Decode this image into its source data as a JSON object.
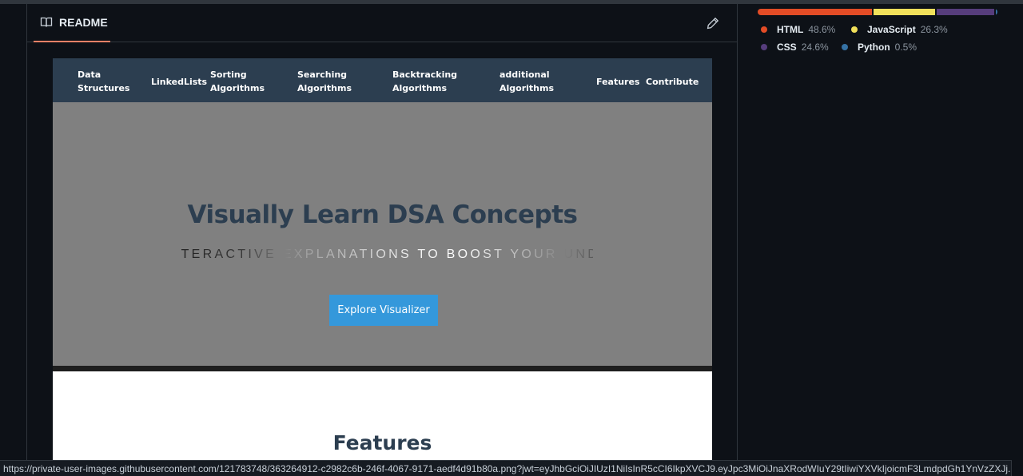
{
  "readme": {
    "tab_label": "README",
    "icons": {
      "tab": "book-icon",
      "edit": "pencil-icon"
    }
  },
  "embedded_site": {
    "nav": [
      {
        "label": "Data Structures"
      },
      {
        "label": "LinkedLists"
      },
      {
        "label": "Sorting Algorithms"
      },
      {
        "label": "Searching Algorithms"
      },
      {
        "label": "Backtracking Algorithms"
      },
      {
        "label": "additional Algorithms"
      },
      {
        "label": "Features"
      },
      {
        "label": "Contribute"
      }
    ],
    "hero_title": "Visually Learn DSA Concepts",
    "hero_subtitle": "INTERACTIVE EXPLANATIONS TO BOOST YOUR UNDERSTANDING",
    "explore_button": "Explore Visualizer",
    "features_title": "Features",
    "colors": {
      "nav_bg": "#2c3e50",
      "hero_bg": "#808080",
      "title": "#2c3e50",
      "button": "#3498db"
    }
  },
  "languages": [
    {
      "name": "HTML",
      "percent": "48.6%",
      "value": 48.6,
      "color": "#e34c26"
    },
    {
      "name": "JavaScript",
      "percent": "26.3%",
      "value": 26.3,
      "color": "#f1e05a"
    },
    {
      "name": "CSS",
      "percent": "24.6%",
      "value": 24.6,
      "color": "#563d7c"
    },
    {
      "name": "Python",
      "percent": "0.5%",
      "value": 0.5,
      "color": "#3572a5"
    }
  ],
  "status_url": "https://private-user-images.githubusercontent.com/121783748/363264912-c2982c6b-246f-4067-9171-aedf4d91b80a.png?jwt=eyJhbGciOiJIUzI1NiIsInR5cCI6IkpXVCJ9.eyJpc3MiOiJnaXRodWIuY29tIiwiYXVkIjoicmF3LmdpdGh1YnVzZXJj..."
}
